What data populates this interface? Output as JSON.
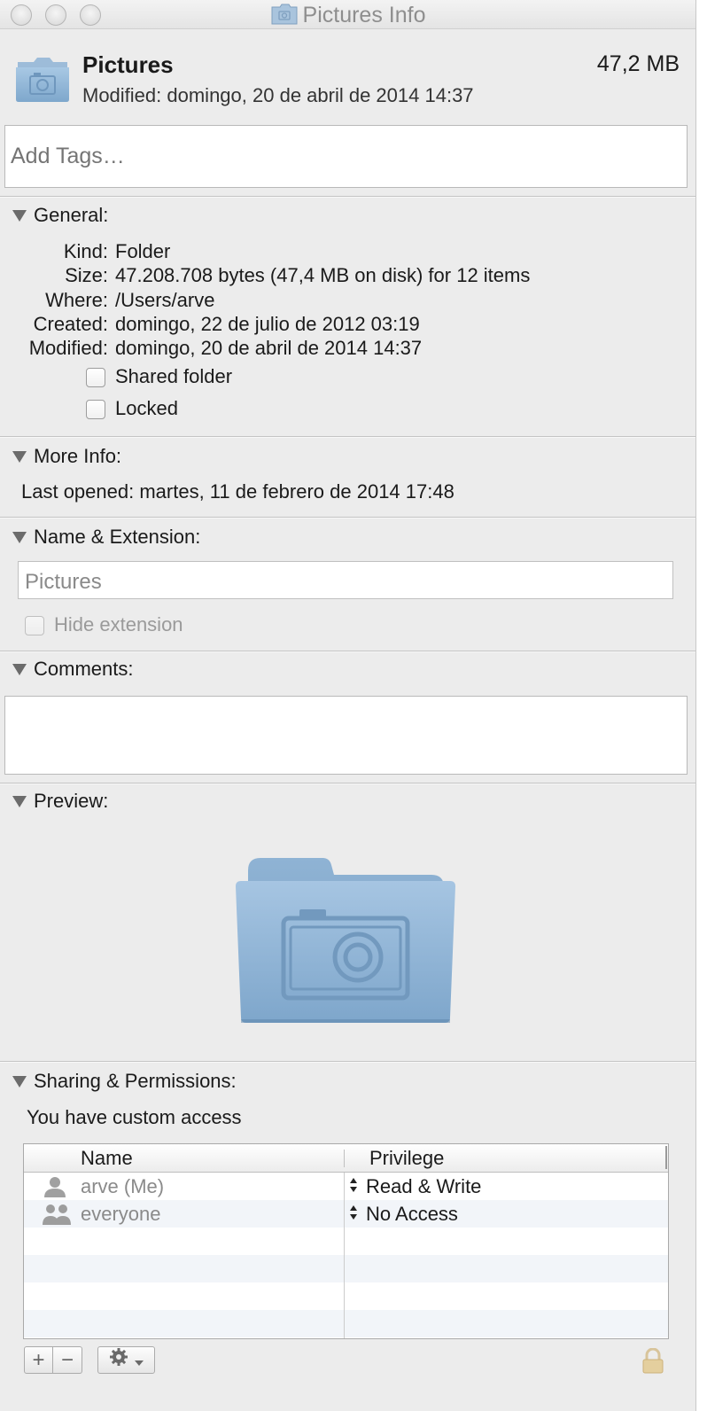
{
  "window": {
    "title": "Pictures Info"
  },
  "header": {
    "name": "Pictures",
    "size": "47,2 MB",
    "modified": "Modified: domingo, 20 de abril de 2014 14:37"
  },
  "tags": {
    "placeholder": "Add Tags…"
  },
  "general": {
    "title": "General:",
    "rows": [
      {
        "key": "Kind:",
        "value": "Folder"
      },
      {
        "key": "Size:",
        "value": "47.208.708 bytes (47,4 MB on disk) for 12 items"
      },
      {
        "key": "Where:",
        "value": "/Users/arve"
      },
      {
        "key": "Created:",
        "value": "domingo, 22 de julio de 2012 03:19"
      },
      {
        "key": "Modified:",
        "value": "domingo, 20 de abril de 2014 14:37"
      }
    ],
    "shared_folder": {
      "label": "Shared folder",
      "checked": false
    },
    "locked": {
      "label": "Locked",
      "checked": false
    }
  },
  "more_info": {
    "title": "More Info:",
    "last_opened": "Last opened: martes, 11 de febrero de 2014 17:48"
  },
  "name_ext": {
    "title": "Name & Extension:",
    "value": "Pictures",
    "hide_extension": {
      "label": "Hide extension",
      "checked": false,
      "enabled": false
    }
  },
  "comments": {
    "title": "Comments:",
    "value": ""
  },
  "preview": {
    "title": "Preview:",
    "icon": "pictures-folder-icon"
  },
  "sharing": {
    "title": "Sharing & Permissions:",
    "access_note": "You have custom access",
    "columns": {
      "name": "Name",
      "privilege": "Privilege"
    },
    "rows": [
      {
        "name": "arve (Me)",
        "privilege": "Read & Write",
        "icon": "user-icon"
      },
      {
        "name": "everyone",
        "privilege": "No Access",
        "icon": "group-icon"
      }
    ],
    "add_label": "+",
    "remove_label": "−"
  },
  "colors": {
    "folder_blue": "#8db4d6",
    "window_bg": "#ececec",
    "alt_row": "#f2f5f9"
  }
}
